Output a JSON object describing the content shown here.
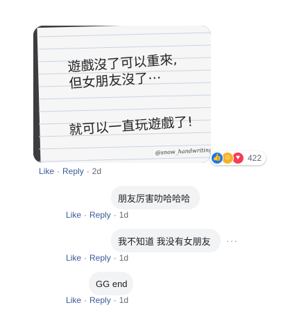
{
  "post": {
    "image_text": {
      "line1": "遊戲沒了可以重來,",
      "line2": "但女朋友沒了⋯",
      "line3": "就可以一直玩遊戲了!",
      "signature": "@snow_handwriting"
    },
    "reaction_count": "422",
    "actions": {
      "like": "Like",
      "reply": "Reply",
      "time": "2d"
    }
  },
  "replies": [
    {
      "text": "朋友厉害叻哈哈哈",
      "like": "Like",
      "reply": "Reply",
      "time": "1d"
    },
    {
      "text": "我不知道 我没有女朋友",
      "like": "Like",
      "reply": "Reply",
      "time": "1d",
      "more": "···"
    },
    {
      "text": "GG end",
      "like": "Like",
      "reply": "Reply",
      "time": "1d"
    }
  ]
}
